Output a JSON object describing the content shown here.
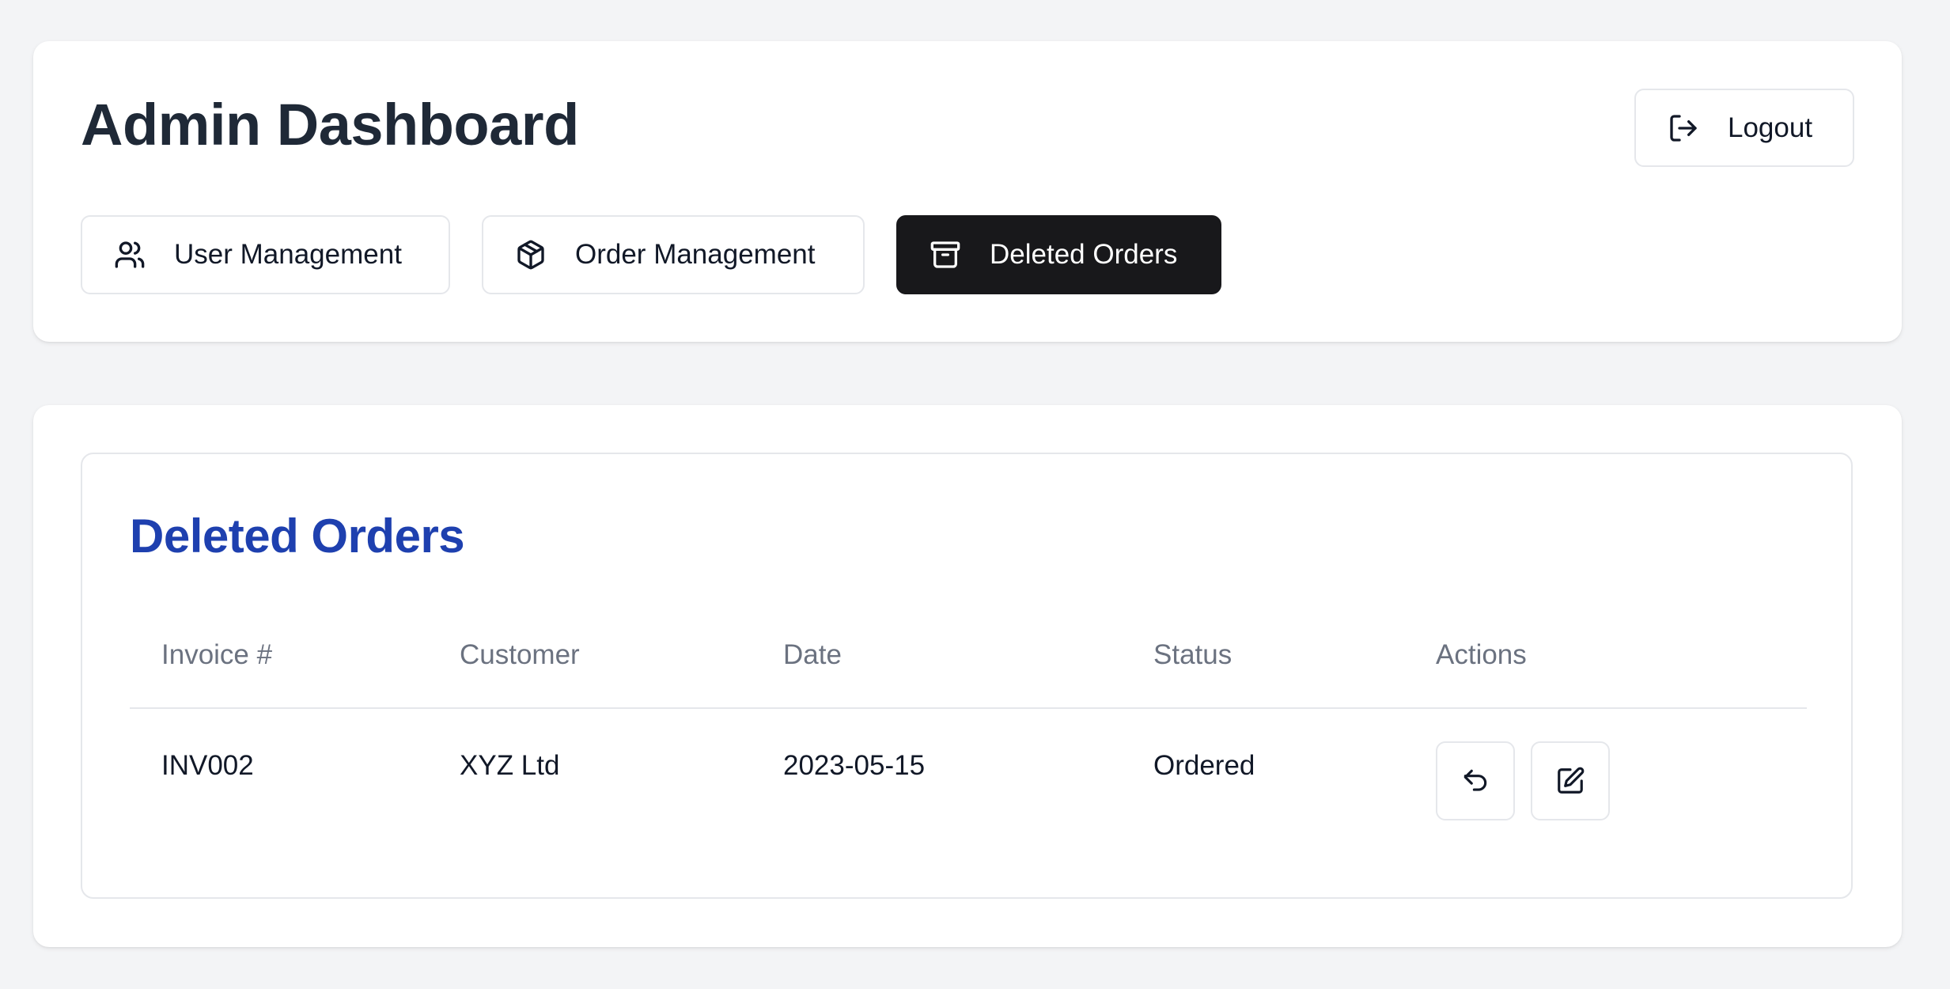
{
  "header": {
    "title": "Admin Dashboard",
    "logout_label": "Logout",
    "logout_icon": "logout-icon"
  },
  "tabs": [
    {
      "label": "User Management",
      "icon": "users-icon",
      "active": false
    },
    {
      "label": "Order Management",
      "icon": "package-icon",
      "active": false
    },
    {
      "label": "Deleted Orders",
      "icon": "archive-icon",
      "active": true
    }
  ],
  "deleted_orders": {
    "title": "Deleted Orders",
    "columns": [
      "Invoice #",
      "Customer",
      "Date",
      "Status",
      "Actions"
    ],
    "rows": [
      {
        "invoice": "INV002",
        "customer": "XYZ Ltd",
        "date": "2023-05-15",
        "status": "Ordered",
        "actions": [
          "restore-icon",
          "edit-icon"
        ]
      }
    ]
  },
  "colors": {
    "background": "#f3f4f6",
    "card": "#ffffff",
    "active_tab": "#18181b",
    "section_title": "#1e40af",
    "header_text": "#6b7280",
    "border": "#e5e7eb"
  }
}
